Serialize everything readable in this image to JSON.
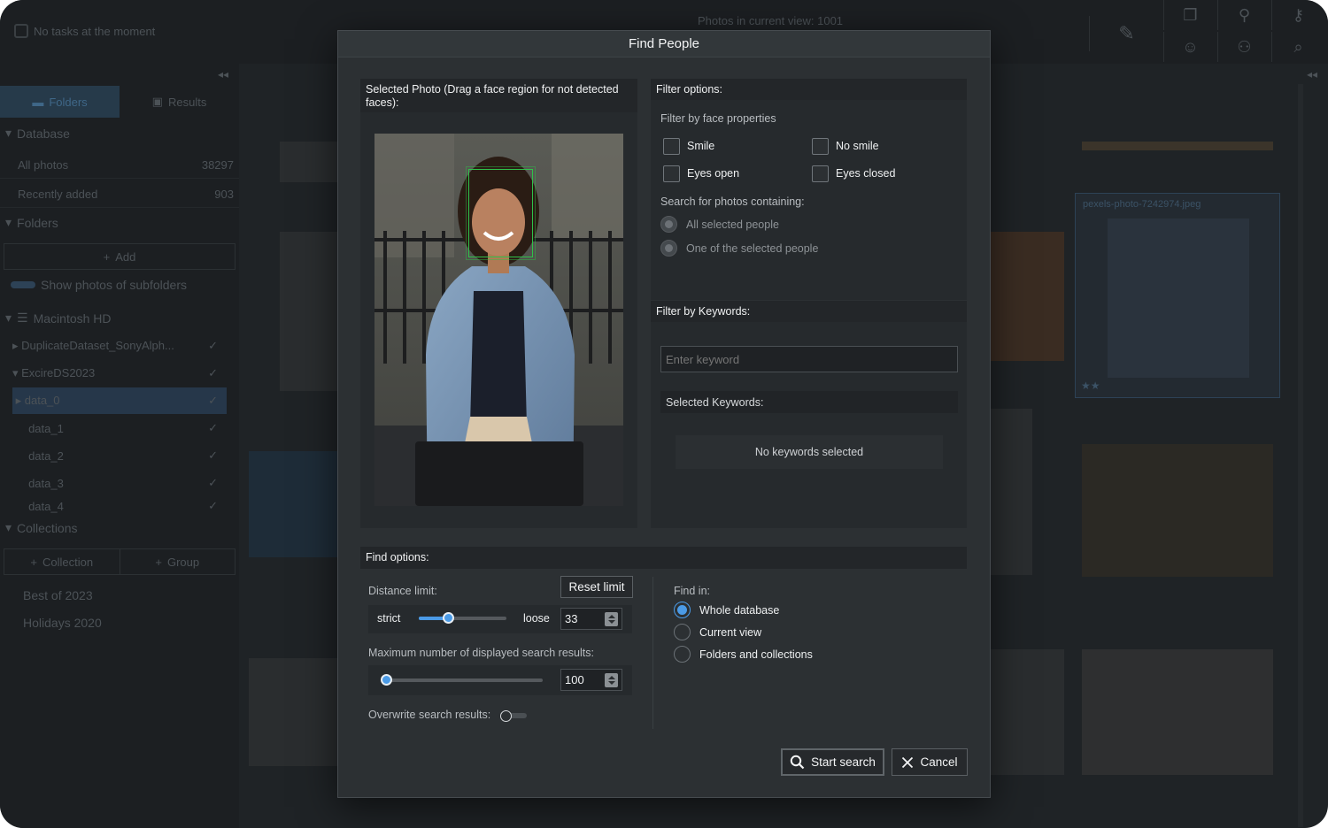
{
  "background": {
    "task_status": "No tasks at the moment",
    "photos_in_view": "Photos in current view: 1001",
    "tabs": [
      "Folders",
      "Results"
    ],
    "database_label": "Database",
    "all_photos": {
      "label": "All photos",
      "count": "38297"
    },
    "recently_added": {
      "label": "Recently added",
      "count": "903"
    },
    "folders_label": "Folders",
    "add_label": "Add",
    "show_subfolders": "Show photos of subfolders",
    "volume": "Macintosh HD",
    "tree": [
      "DuplicateDataset_SonyAlph...",
      "ExcireDS2023",
      "data_0",
      "data_1",
      "data_2",
      "data_3",
      "data_4"
    ],
    "collections_label": "Collections",
    "collection_btn": "Collection",
    "group_btn": "Group",
    "collections": [
      "Best of 2023",
      "Holidays 2020"
    ],
    "selected_thumb_name": "pexels-photo-7242974.jpeg"
  },
  "dialog": {
    "title": "Find People",
    "photo_header": "Selected Photo (Drag a face region for not detected faces):",
    "filter_options_header": "Filter options:",
    "face_props_label": "Filter by face properties",
    "face_props": {
      "smile": "Smile",
      "no_smile": "No smile",
      "eyes_open": "Eyes open",
      "eyes_closed": "Eyes closed"
    },
    "search_containing_label": "Search for photos containing:",
    "search_containing": [
      "All selected people",
      "One of the selected people"
    ],
    "keywords_header": "Filter by Keywords:",
    "keyword_placeholder": "Enter keyword",
    "selected_keywords_label": "Selected Keywords:",
    "no_keywords": "No keywords selected",
    "find_options_header": "Find options:",
    "distance_limit_label": "Distance limit:",
    "reset_limit": "Reset limit",
    "strict": "strict",
    "loose": "loose",
    "distance_value": "33",
    "distance_fraction": 0.34,
    "max_results_label": "Maximum number of displayed search results:",
    "max_results_value": "100",
    "max_results_fraction": 0.0,
    "overwrite_label": "Overwrite search results:",
    "overwrite_on": false,
    "find_in_label": "Find in:",
    "find_in": [
      "Whole database",
      "Current view",
      "Folders and collections"
    ],
    "find_in_selected": 0,
    "start_search": "Start search",
    "cancel": "Cancel",
    "accent_color": "#4b9be7",
    "face_box_color": "#2fc24a"
  }
}
